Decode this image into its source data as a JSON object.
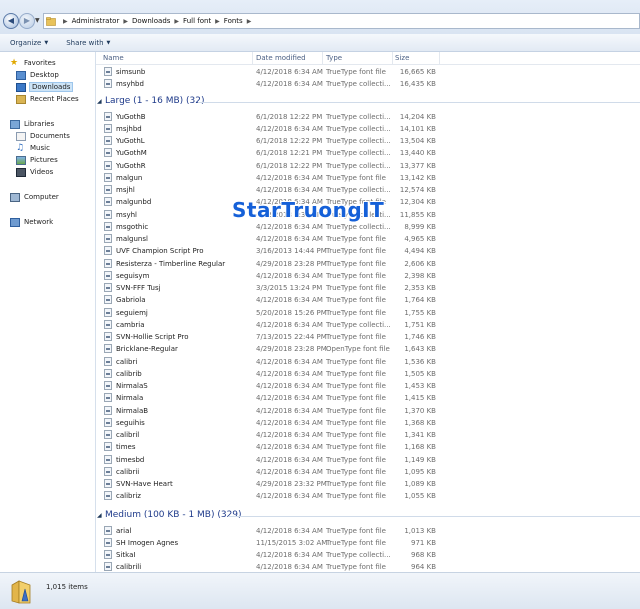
{
  "breadcrumb": [
    "Administrator",
    "Downloads",
    "Full font",
    "Fonts"
  ],
  "toolbar": {
    "organize": "Organize",
    "share_with": "Share with"
  },
  "nav": {
    "favorites": "Favorites",
    "desktop": "Desktop",
    "downloads": "Downloads",
    "recent_places": "Recent Places",
    "libraries": "Libraries",
    "documents": "Documents",
    "music": "Music",
    "pictures": "Pictures",
    "videos": "Videos",
    "computer": "Computer",
    "network": "Network"
  },
  "columns": {
    "name": "Name",
    "date": "Date modified",
    "type": "Type",
    "size": "Size"
  },
  "top_rows": [
    {
      "name": "simsunb",
      "date": "4/12/2018 6:34 AM",
      "type": "TrueType font file",
      "size": "16,665 KB"
    },
    {
      "name": "msyhbd",
      "date": "4/12/2018 6:34 AM",
      "type": "TrueType collecti...",
      "size": "16,435 KB"
    }
  ],
  "group_large": "Large (1 - 16 MB) (32)",
  "large_rows": [
    {
      "name": "YuGothB",
      "date": "6/1/2018 12:22 PM",
      "type": "TrueType collecti...",
      "size": "14,204 KB"
    },
    {
      "name": "msjhbd",
      "date": "4/12/2018 6:34 AM",
      "type": "TrueType collecti...",
      "size": "14,101 KB"
    },
    {
      "name": "YuGothL",
      "date": "6/1/2018 12:22 PM",
      "type": "TrueType collecti...",
      "size": "13,504 KB"
    },
    {
      "name": "YuGothM",
      "date": "6/1/2018 12:21 PM",
      "type": "TrueType collecti...",
      "size": "13,440 KB"
    },
    {
      "name": "YuGothR",
      "date": "6/1/2018 12:22 PM",
      "type": "TrueType collecti...",
      "size": "13,377 KB"
    },
    {
      "name": "malgun",
      "date": "4/12/2018 6:34 AM",
      "type": "TrueType font file",
      "size": "13,142 KB"
    },
    {
      "name": "msjhl",
      "date": "4/12/2018 6:34 AM",
      "type": "TrueType collecti...",
      "size": "12,574 KB"
    },
    {
      "name": "malgunbd",
      "date": "4/12/2018 6:34 AM",
      "type": "TrueType font file",
      "size": "12,304 KB"
    },
    {
      "name": "msyhl",
      "date": "4/12/2018 6:34 AM",
      "type": "TrueType collecti...",
      "size": "11,855 KB"
    },
    {
      "name": "msgothic",
      "date": "4/12/2018 6:34 AM",
      "type": "TrueType collecti...",
      "size": "8,999 KB"
    },
    {
      "name": "malgunsl",
      "date": "4/12/2018 6:34 AM",
      "type": "TrueType font file",
      "size": "4,965 KB"
    },
    {
      "name": "UVF Champion Script Pro",
      "date": "3/16/2013 14:44 PM",
      "type": "TrueType font file",
      "size": "4,494 KB"
    },
    {
      "name": "Resisterza - Timberline Regular",
      "date": "4/29/2018 23:28 PM",
      "type": "TrueType font file",
      "size": "2,606 KB"
    },
    {
      "name": "seguisym",
      "date": "4/12/2018 6:34 AM",
      "type": "TrueType font file",
      "size": "2,398 KB"
    },
    {
      "name": "SVN-FFF Tusj",
      "date": "3/3/2015 13:24 PM",
      "type": "TrueType font file",
      "size": "2,353 KB"
    },
    {
      "name": "Gabriola",
      "date": "4/12/2018 6:34 AM",
      "type": "TrueType font file",
      "size": "1,764 KB"
    },
    {
      "name": "seguiemj",
      "date": "5/20/2018 15:26 PM",
      "type": "TrueType font file",
      "size": "1,755 KB"
    },
    {
      "name": "cambria",
      "date": "4/12/2018 6:34 AM",
      "type": "TrueType collecti...",
      "size": "1,751 KB"
    },
    {
      "name": "SVN-Hollie Script Pro",
      "date": "7/13/2015 22:44 PM",
      "type": "TrueType font file",
      "size": "1,746 KB"
    },
    {
      "name": "Bricklane-Regular",
      "date": "4/29/2018 23:28 PM",
      "type": "OpenType font file",
      "size": "1,643 KB"
    },
    {
      "name": "calibri",
      "date": "4/12/2018 6:34 AM",
      "type": "TrueType font file",
      "size": "1,536 KB"
    },
    {
      "name": "calibrib",
      "date": "4/12/2018 6:34 AM",
      "type": "TrueType font file",
      "size": "1,505 KB"
    },
    {
      "name": "NirmalaS",
      "date": "4/12/2018 6:34 AM",
      "type": "TrueType font file",
      "size": "1,453 KB"
    },
    {
      "name": "Nirmala",
      "date": "4/12/2018 6:34 AM",
      "type": "TrueType font file",
      "size": "1,415 KB"
    },
    {
      "name": "NirmalaB",
      "date": "4/12/2018 6:34 AM",
      "type": "TrueType font file",
      "size": "1,370 KB"
    },
    {
      "name": "seguihis",
      "date": "4/12/2018 6:34 AM",
      "type": "TrueType font file",
      "size": "1,368 KB"
    },
    {
      "name": "calibril",
      "date": "4/12/2018 6:34 AM",
      "type": "TrueType font file",
      "size": "1,341 KB"
    },
    {
      "name": "times",
      "date": "4/12/2018 6:34 AM",
      "type": "TrueType font file",
      "size": "1,168 KB"
    },
    {
      "name": "timesbd",
      "date": "4/12/2018 6:34 AM",
      "type": "TrueType font file",
      "size": "1,149 KB"
    },
    {
      "name": "calibrii",
      "date": "4/12/2018 6:34 AM",
      "type": "TrueType font file",
      "size": "1,095 KB"
    },
    {
      "name": "SVN-Have Heart",
      "date": "4/29/2018 23:32 PM",
      "type": "TrueType font file",
      "size": "1,089 KB"
    },
    {
      "name": "calibriz",
      "date": "4/12/2018 6:34 AM",
      "type": "TrueType font file",
      "size": "1,055 KB"
    }
  ],
  "group_medium": "Medium (100 KB - 1 MB) (329)",
  "medium_rows": [
    {
      "name": "arial",
      "date": "4/12/2018 6:34 AM",
      "type": "TrueType font file",
      "size": "1,013 KB"
    },
    {
      "name": "SH Imogen Agnes",
      "date": "11/15/2015 3:02 AM",
      "type": "TrueType font file",
      "size": "971 KB"
    },
    {
      "name": "SitkaI",
      "date": "4/12/2018 6:34 AM",
      "type": "TrueType collecti...",
      "size": "968 KB"
    },
    {
      "name": "calibrili",
      "date": "4/12/2018 6:34 AM",
      "type": "TrueType font file",
      "size": "964 KB"
    },
    {
      "name": "arialbd",
      "date": "4/12/2018 6:34 AM",
      "type": "TrueType font file",
      "size": "958 KB"
    }
  ],
  "watermark": "StarTruongIT",
  "status": {
    "count": "1,015 items"
  },
  "colors": {
    "group_title": "#1e3a8a",
    "selection": "#cde4f7",
    "watermark": "#1560d8"
  }
}
